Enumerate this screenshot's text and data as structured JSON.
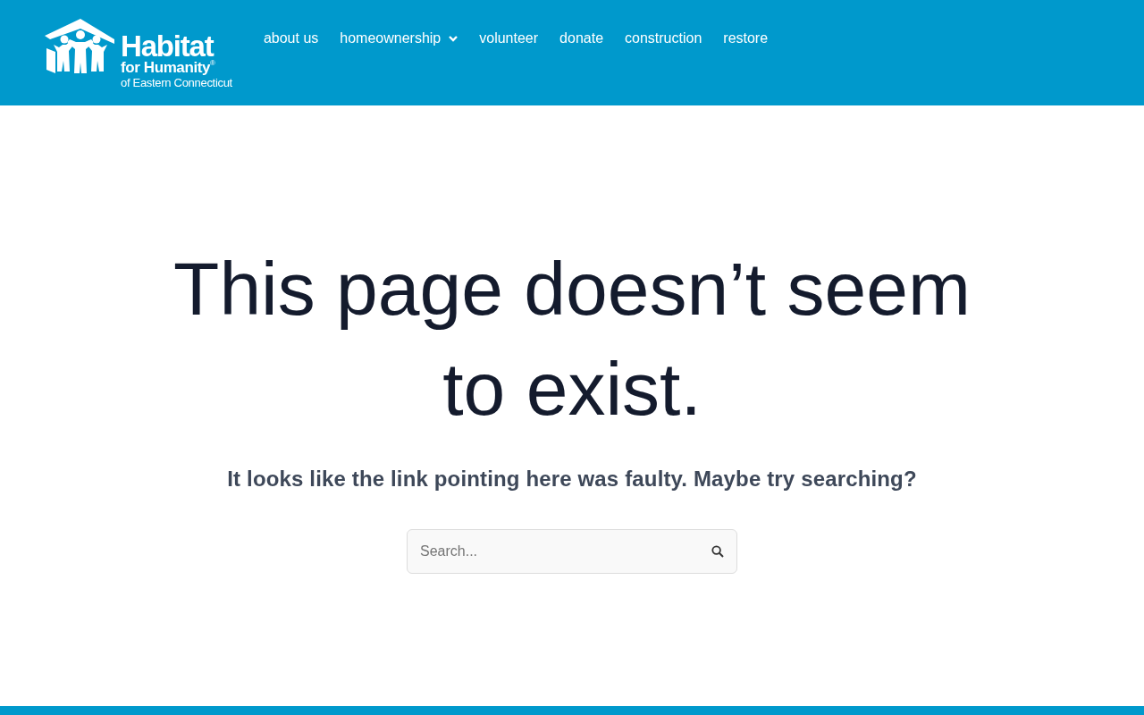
{
  "header": {
    "logo": {
      "title": "Habitat",
      "subtitle": "for Humanity$^{®}$",
      "region": "of Eastern Connecticut"
    },
    "nav": [
      {
        "label": "about us",
        "has_submenu": false
      },
      {
        "label": "homeownership",
        "has_submenu": true
      },
      {
        "label": "volunteer",
        "has_submenu": false
      },
      {
        "label": "donate",
        "has_submenu": false
      },
      {
        "label": "construction",
        "has_submenu": false
      },
      {
        "label": "restore",
        "has_submenu": false
      }
    ]
  },
  "main": {
    "heading": "This page doesn’t seem to exist.",
    "message": "It looks like the link pointing here was faulty. Maybe try searching?",
    "search": {
      "placeholder": "Search..."
    }
  }
}
